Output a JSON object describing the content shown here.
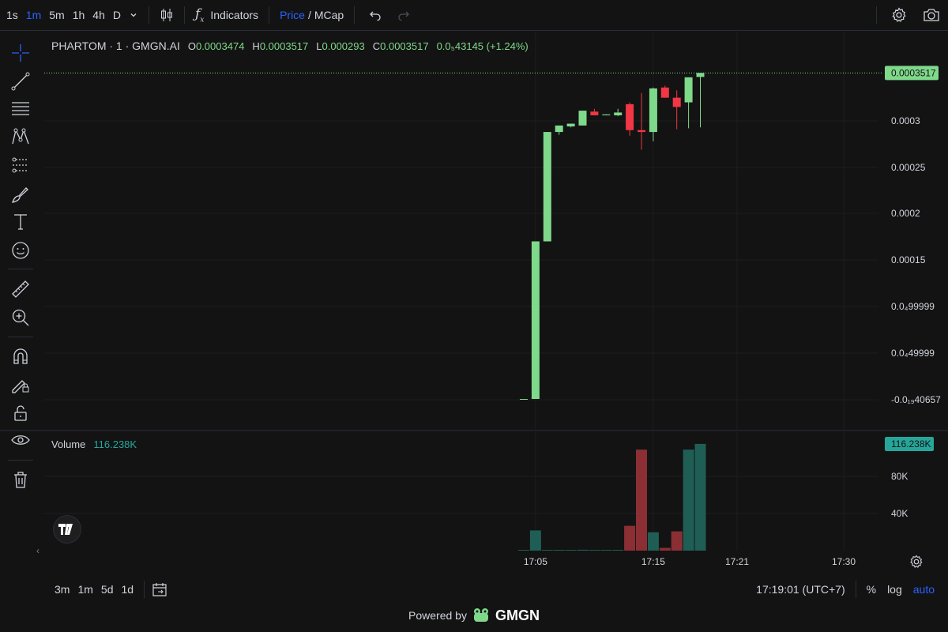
{
  "topbar": {
    "intervals": [
      "1s",
      "1m",
      "5m",
      "1h",
      "4h",
      "D"
    ],
    "active_interval": "1m",
    "indicators_label": "Indicators",
    "price_label": "Price",
    "divider": "/",
    "mcap_label": "MCap"
  },
  "legend": {
    "symbol": "PHARTOM · 1 · GMGN.AI",
    "o_label": "O",
    "o_value": "0.0003474",
    "h_label": "H",
    "h_value": "0.0003517",
    "l_label": "L",
    "l_value": "0.000293",
    "c_label": "C",
    "c_value": "0.0003517",
    "change": "0.0₅43145 (+1.24%)"
  },
  "volume_legend": {
    "label": "Volume",
    "value": "116.238K"
  },
  "price_axis": {
    "current_price": "0.0003517",
    "ticks": [
      "0.0003",
      "0.00025",
      "0.0002",
      "0.00015",
      "0.0₄99999",
      "0.0₄49999",
      "-0.0₁₉40657"
    ]
  },
  "volume_axis": {
    "current_volume": "116.238K",
    "ticks": [
      "80K",
      "40K"
    ]
  },
  "time_axis": {
    "ticks": [
      "17:05",
      "17:15",
      "17:21",
      "17:30"
    ]
  },
  "bottombar": {
    "ranges": [
      "3m",
      "1m",
      "5d",
      "1d"
    ],
    "clock": "17:19:01 (UTC+7)",
    "percent": "%",
    "log": "log",
    "auto": "auto"
  },
  "footer": {
    "powered_by": "Powered by",
    "brand": "GMGN"
  },
  "colors": {
    "up": "#7fd98b",
    "down": "#f23645",
    "vol_up": "#1f5e54",
    "vol_down": "#8b2f35",
    "accent": "#2962ff",
    "bg": "#131313"
  },
  "chart_data": {
    "type": "candlestick",
    "candles": [
      {
        "t": "17:04",
        "o": 0.0,
        "h": 0.0,
        "l": 0.0,
        "c": 0.0,
        "v": 0
      },
      {
        "t": "17:05",
        "o": 0.0,
        "h": 0.00017,
        "l": 0.0,
        "c": 0.00017,
        "v": 22000
      },
      {
        "t": "17:06",
        "o": 0.00017,
        "h": 0.000288,
        "l": 0.00017,
        "c": 0.000288,
        "v": 0
      },
      {
        "t": "17:07",
        "o": 0.000288,
        "h": 0.000295,
        "l": 0.000285,
        "c": 0.000295,
        "v": 0
      },
      {
        "t": "17:08",
        "o": 0.000294,
        "h": 0.000297,
        "l": 0.000293,
        "c": 0.000297,
        "v": 0
      },
      {
        "t": "17:09",
        "o": 0.000295,
        "h": 0.000311,
        "l": 0.000295,
        "c": 0.000311,
        "v": 1000
      },
      {
        "t": "17:10",
        "o": 0.00031,
        "h": 0.000313,
        "l": 0.000306,
        "c": 0.000306,
        "v": 0
      },
      {
        "t": "17:11",
        "o": 0.000306,
        "h": 0.000307,
        "l": 0.000306,
        "c": 0.000307,
        "v": 0
      },
      {
        "t": "17:12",
        "o": 0.000306,
        "h": 0.000313,
        "l": 0.000305,
        "c": 0.000309,
        "v": 0
      },
      {
        "t": "17:13",
        "o": 0.000318,
        "h": 0.00032,
        "l": 0.000284,
        "c": 0.00029,
        "v": 27000
      },
      {
        "t": "17:14",
        "o": 0.00029,
        "h": 0.00033,
        "l": 0.000269,
        "c": 0.000288,
        "v": 110000
      },
      {
        "t": "17:15",
        "o": 0.000288,
        "h": 0.000336,
        "l": 0.000278,
        "c": 0.000335,
        "v": 20000
      },
      {
        "t": "17:16",
        "o": 0.000336,
        "h": 0.000338,
        "l": 0.000325,
        "c": 0.000325,
        "v": 3000
      },
      {
        "t": "17:17",
        "o": 0.000325,
        "h": 0.000333,
        "l": 0.000291,
        "c": 0.000315,
        "v": 21000
      },
      {
        "t": "17:18",
        "o": 0.00032,
        "h": 0.000347,
        "l": 0.000292,
        "c": 0.000347,
        "v": 110000
      },
      {
        "t": "17:19",
        "o": 0.0003474,
        "h": 0.0003517,
        "l": 0.000293,
        "c": 0.0003517,
        "v": 116238
      }
    ]
  }
}
